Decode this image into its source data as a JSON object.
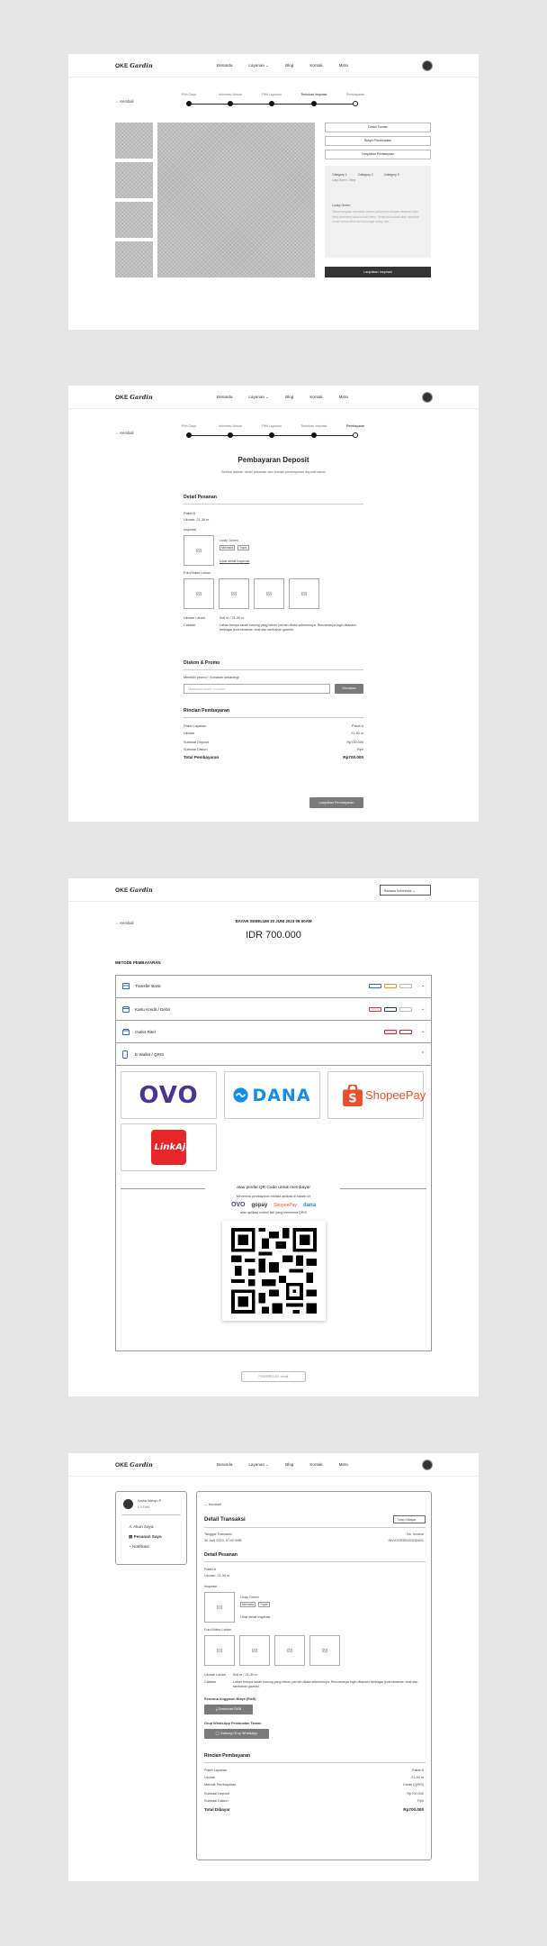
{
  "common": {
    "logo_main": "OKE",
    "logo_italic": "Gardin",
    "nav": [
      "Beranda",
      "Layanan ⌄",
      "Blog",
      "Kontak",
      "Mitra"
    ],
    "back": "← Kembali"
  },
  "steps": [
    "Pilih Gaya",
    "Informasi Umum",
    "Pilih Layanan",
    "Tentukan Inspirasi",
    "Pembayaran"
  ],
  "s1": {
    "buttons": [
      "Detail Taman",
      "Biaya Pembuatan",
      "Tanyakan Pertanyaan"
    ],
    "categories": [
      "Category 1",
      "Category 2",
      "Category 3"
    ],
    "category_sub": "Lusy Green - Mirip",
    "style_name": "Lucky Green",
    "desc": "Taman bergaya minimalis modern yang fresh dengan tanaman hijau yang dirancang untuk rumah kamu. Sentuhan natural akan membuat rumah terasa lebih asri dan segar setiap hari.",
    "cta": "Lanjutkan Inspirasi"
  },
  "s2": {
    "title": "Pembayaran Deposit",
    "subtitle": "Berikut adalah detail pesanan dan rincian pembayaran deposit kamu",
    "detail_title": "Detail Pesanan",
    "paket": "Paket A",
    "ukuran": "Ukuran: 21-30 m",
    "inspirasi": "Inspirasi",
    "style": "Lusty Green",
    "tags": [
      "Minimalis",
      "Tropis"
    ],
    "lihat": "Lihat detail inspirasi",
    "foto": "Foto/Video Lahan",
    "ukuran_lahan_lbl": "Ukuran Lahan",
    "ukuran_lahan_val": "5x6 m / 21-30 m",
    "catatan_lbl": "Catatan",
    "catatan_val": "Lahan berupa tanah kosong yang belum pernah ditata sebelumnya. Rencananya ingin ditanami berbagai jenis tanaman obat dan tambahan gazebo.",
    "promo_title": "Diskon & Promo",
    "promo_q": "Memiliki promo? Gunakan sekarang!",
    "promo_placeholder": "Masukkan kode voucher",
    "promo_btn": "Gunakan",
    "rincian_title": "Rincian Pembayaran",
    "rows": [
      [
        "Paket Layanan",
        "Paket A"
      ],
      [
        "Ukuran",
        "21-30 m"
      ],
      [
        "Subtotal Deposit",
        "Rp700.000"
      ],
      [
        "Subtotal Diskon",
        "Rp0"
      ]
    ],
    "total_lbl": "Total Pembayaran",
    "total_val": "Rp700.000",
    "cta": "Lanjutkan Pembayaran"
  },
  "s3": {
    "lang": "Bahasa Indonesia ⌄",
    "deadline": "BAYAR SEBELUM 30 JUNI 2023 09:00AM",
    "amount": "IDR 700.000",
    "method_title": "METODE PEMBAYARAN",
    "methods": [
      "Transfer Bank",
      "Kartu Kredit / Debit",
      "Outlet Ritel",
      "E-Wallet / QRIS"
    ],
    "wallets": [
      "OVO",
      "DANA",
      "ShopeePay",
      "LinkAja!"
    ],
    "qr_title": "atau pindai QR Code untuk membayar",
    "qr_sub1": "Menerima pembayaran melalui aplikasi di bawah ini",
    "qr_sub2": "atau aplikasi mobile lain yang menerima QRIS",
    "qr_brands": [
      "OVO",
      "gopay",
      "ShopeePay",
      "dana"
    ],
    "powered": "POWERED BY xendit"
  },
  "s4": {
    "user_name": "Katha Wahyu P",
    "user_sub": "0.0 Point",
    "menu": [
      "Akun Saya",
      "Pesanan Saya",
      "Notifikasi"
    ],
    "back": "← Kembali",
    "title": "Detail Transaksi",
    "tutup": "Tutup Dibayar",
    "tgl_lbl": "Tanggal Transaksi",
    "tgl_val": "30 Juni 2023, 07:00 WIB",
    "inv_lbl": "No. Invoice",
    "inv_val": "INV/OGRDN/20230401",
    "detail": "Detail Pesanan",
    "paket": "Paket A",
    "ukuran": "Ukuran: 21-30 m",
    "inspirasi": "Inspirasi",
    "style": "Lusty Green",
    "tags": [
      "Minimalis",
      "Tropis"
    ],
    "lihat": "Lihat detail inspirasi",
    "foto": "Foto/Video Lahan",
    "ul_lbl": "Ukuran Lahan",
    "ul_val": "5x6 m / 21-30 m",
    "cat_lbl": "Catatan",
    "cat_val": "Lahan berupa tanah kosong yang belum pernah ditata sebelumnya. Rencananya ingin ditanami berbagai jenis tanaman obat dan tambahan gazebo.",
    "rab_lbl": "Rencana Anggaran Biaya (RAB)",
    "rab_btn": "Download RAB",
    "wa_lbl": "Grup WhatsApp Pembuatan Taman",
    "wa_btn": "Gabung Grup WhatsApp",
    "rincian": "Rincian Pembayaran",
    "rows": [
      [
        "Paket Layanan",
        "Paket A"
      ],
      [
        "Ukuran",
        "21-30 m"
      ],
      [
        "Metode Pembayaran",
        "Kredit (QRIS)"
      ],
      [
        "Subtotal Deposit",
        "Rp700.000"
      ],
      [
        "Subtotal Diskon",
        "Rp0"
      ]
    ],
    "total_lbl": "Total Dibayar",
    "total_val": "Rp700.000"
  },
  "colors": {
    "ovo": "#4c3494",
    "dana": "#118eea",
    "shopee": "#ee4d2d",
    "linkaja": "#e82529",
    "dark": "#333333"
  }
}
